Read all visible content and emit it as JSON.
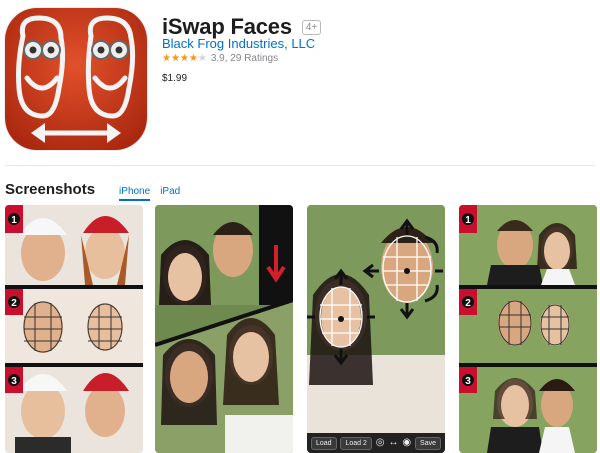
{
  "app": {
    "title": "iSwap Faces",
    "age_rating": "4+",
    "developer": "Black Frog Industries, LLC",
    "rating_value": "3.9",
    "rating_count": "29 Ratings",
    "rating_text": "3.9, 29 Ratings",
    "stars_filled": 4,
    "stars_total": 5,
    "price": "$1.99",
    "icon_color": "#d13f1d"
  },
  "screenshots_section": {
    "title": "Screenshots",
    "tabs": [
      {
        "label": "iPhone",
        "active": true
      },
      {
        "label": "iPad",
        "active": false
      }
    ]
  },
  "screenshots": [
    {
      "steps": [
        "1",
        "2",
        "3"
      ]
    },
    {
      "steps": []
    },
    {
      "toolbar": {
        "load": "Load",
        "load2": "Load 2",
        "save": "Save"
      }
    },
    {
      "steps": [
        "1",
        "2",
        "3"
      ]
    }
  ],
  "colors": {
    "link": "#0070c9",
    "star": "#ff9500",
    "step_bar": "#c8102e"
  }
}
